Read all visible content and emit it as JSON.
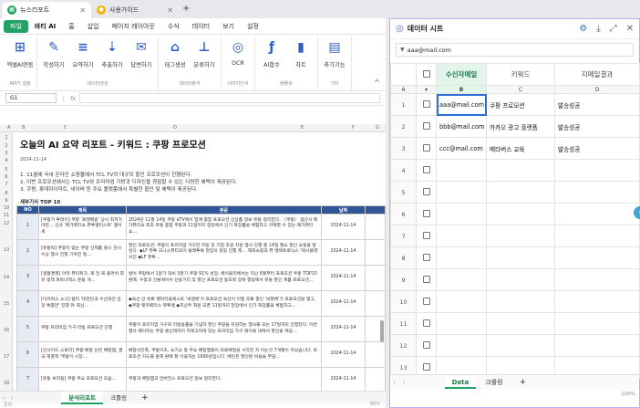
{
  "tabs": [
    {
      "label": "뉴스리포트",
      "icon_color": "#21a366"
    },
    {
      "label": "사용가이드",
      "icon_color": "#f0b400"
    }
  ],
  "new_tab": "+",
  "menus": [
    "파일",
    "바티 AI",
    "홈",
    "삽입",
    "페이지 레이아웃",
    "수식",
    "데이터",
    "보기",
    "설정"
  ],
  "ribbon": {
    "groups": [
      {
        "label": "API키 설정",
        "buttons": [
          {
            "label": "엑셀AI연동",
            "icon": "excel-ai-icon"
          }
        ]
      },
      {
        "label": "데이터생성",
        "buttons": [
          {
            "label": "작성하기",
            "icon": "write-icon"
          },
          {
            "label": "요약하기",
            "icon": "summarize-icon"
          },
          {
            "label": "추출하기",
            "icon": "extract-icon"
          },
          {
            "label": "답변하기",
            "icon": "answer-icon"
          }
        ]
      },
      {
        "label": "데이터분석",
        "buttons": [
          {
            "label": "태그생성",
            "icon": "tag-icon"
          },
          {
            "label": "분류하기",
            "icon": "classify-icon"
          }
        ]
      },
      {
        "label": "이미지인식",
        "buttons": [
          {
            "label": "OCR",
            "icon": "ocr-icon"
          }
        ]
      },
      {
        "label": "템플릿",
        "buttons": [
          {
            "label": "AI함수",
            "icon": "function-icon"
          },
          {
            "label": "차트",
            "icon": "chart-icon"
          }
        ]
      },
      {
        "label": "기타",
        "buttons": [
          {
            "label": "추가기능",
            "icon": "etc-icon"
          }
        ]
      }
    ]
  },
  "formula": {
    "cell": "G1",
    "fx": "fx"
  },
  "columns": [
    "A",
    "B",
    "C",
    "D",
    "E",
    "F",
    "G"
  ],
  "doc": {
    "title": "오늘의 AI 요약 리포트 - 키워드 : 쿠팡 프로모션",
    "date": "2024-11-14",
    "summary": [
      "1. 11월에 국내 온라인 쇼핑몰에서 TCL TV의 대규모 할인 프로모션이 진행된다.",
      "2. 이번 프로모션에서는 TCL TV와 프리미엄 가방과 디자인을 경험할 수 있는 다양한 혜택이 제공된다.",
      "3. 쿠팡, 롯데하이마트, 네이버 등 주요 플랫폼에서 특별한 할인 및 혜택이 제공된다."
    ],
    "top_title": "세부기사 TOP 10",
    "headers": [
      "NO",
      "제목",
      "본문",
      "날짜",
      ""
    ],
    "rows": [
      {
        "no": "1",
        "title": "[쿠팡가 투데이] 쿠팡 '로켓배송' 상시 최저가 마련… 신규 '메가뷰티쇼 뷰투엘리스트' 열어 세",
        "body": "2024년 11월 14일 쿠팡 eTV에서 업계 종합 프로모션 신상품 정보 유통 정리한다. 〈쿠팡〉 생산사 메가뷰티쇼 최초 유통 종합 쿠팡과 11일까지 현장에서 인기 화장품을 체험하고 구매할 수 있는 메가뷰티쇼…",
        "date": "2024-11-14"
      },
      {
        "no": "2",
        "title": "[유통픽] 쿠팡이 없는 쿠팡 신제품 출시 전시·수상 행사 진행 기획전 등…",
        "body": "할인 프로모션: 쿠팡이 프리미엄 가구한 리빙 및 기업 후원 지원 행사 진행 중 14일 월요 할인 쇼핑을 알린다. ◆LF 뷰투 모니스뷰티오이 플래투룩 현장의 힐링 진행 제… 해외쇼핑과 뷰 엘렉트로닉스 '텍시블레' 서진 ◆LF 뷰투…",
        "date": "2024-11-14"
      },
      {
        "no": "3",
        "title": "[생활경제] 아마 뷰티위크, 쿡 전 쿡 플러쉬 최유 정책 파트너엑스 운동 개…",
        "body": "방어 쿠팡에서 1분기 대비 3분기 쿠팡 91% 성장, 에이블리에서는 지난 6월부터 프로모션 주문 TOP15 판매. 수정과 건물에어서 산동거리 및 할인 프로모션 동호회 장에 행정에서 유통 할인 제품 프로모션…",
        "date": "2024-11-14"
      },
      {
        "no": "4",
        "title": "[이커머스 소식] 컬리 '대한민국 수산대전 김장 특별전' 진행 外 축산…",
        "body": "◆숙선 안 쥬류 펫러리블룩스트 '씨젠에'가 프로모션 숙선이 이필 조류 중인 '씨젠에'가 프로모션을 열고, ◆쿠팡 펫카페리스 뷰투엘 ◆지난주 화원 오픈 11일까지 현장에서 인기 화장품을 체험하고…",
        "date": "2024-11-14"
      },
      {
        "no": "5",
        "title": "쿠팡 프리미엄 가구·리빙 프로모션 진행",
        "body": "쿠팡이 프리미엄 가구와 리빙용품을 기념하 할인 쿠팡을 지원하는 행사를 오는 17일까지 진행한다. 이번 행사 페이지는 쿠팡 홈인테리어 카테고리에 있는 프리미엄 가구 레이블 내에서 할인을 제공…",
        "date": "2024-11-14"
      },
      {
        "no": "6",
        "title": "[인사이드 스토리] 쿠팡·배달 논란 배달앱, 결국 해결책 '쿠팡이 시장…",
        "body": "배달의민족, 쿠팡이츠, 요기요 등 주요 배달앱들이 프로베일을 시작한 지 이는것 7개월이 지났습니다. 프로모션 카드를 통해 판매 잘 이용하는 1990원입니다. 배민은 할인판 비용을 부담…",
        "date": "2024-11-14"
      },
      {
        "no": "7",
        "title": "[유통 브리핑] 쿠팡 주요 프로모션 모음…",
        "body": "쿠팡과 배달앱과 컨버전스 프로모션 정보 정리한다.",
        "date": "2024-11-14"
      }
    ]
  },
  "sheet_tabs": {
    "left": [
      "분석리포트",
      "크롤링"
    ],
    "right": [
      "Data",
      "크롤링"
    ],
    "add": "+"
  },
  "status_left": "준비",
  "status_zoom": "80%",
  "status_zoom_right": "100%",
  "side": {
    "title": "데이터 시트",
    "search": "aaa@mail.com",
    "col_titles": [
      "",
      "수신자메일",
      "키워드",
      "지메일결과"
    ],
    "col_letters": [
      "A",
      "B",
      "C",
      "D"
    ],
    "rows": [
      {
        "n": "1",
        "a": "aaa@mail.com",
        "b": "쿠팡 프로모션",
        "c": "발송성공"
      },
      {
        "n": "2",
        "a": "bbb@mail.com",
        "b": "카카오 광고 플랫폼",
        "c": "발송성공"
      },
      {
        "n": "3",
        "a": "ccc@mail.com",
        "b": "메타버스 교육",
        "c": "발송성공"
      },
      {
        "n": "4",
        "a": "",
        "b": "",
        "c": ""
      },
      {
        "n": "5",
        "a": "",
        "b": "",
        "c": ""
      },
      {
        "n": "6",
        "a": "",
        "b": "",
        "c": ""
      },
      {
        "n": "7",
        "a": "",
        "b": "",
        "c": ""
      },
      {
        "n": "8",
        "a": "",
        "b": "",
        "c": ""
      },
      {
        "n": "9",
        "a": "",
        "b": "",
        "c": ""
      },
      {
        "n": "10",
        "a": "",
        "b": "",
        "c": ""
      },
      {
        "n": "11",
        "a": "",
        "b": "",
        "c": ""
      },
      {
        "n": "12",
        "a": "",
        "b": "",
        "c": ""
      },
      {
        "n": "13",
        "a": "",
        "b": "",
        "c": ""
      }
    ]
  },
  "colors": {
    "accent": "#21a366",
    "header_blue": "#2f5597",
    "side_header_green": "#e3f4ea",
    "selected": "#2b6ed8"
  }
}
